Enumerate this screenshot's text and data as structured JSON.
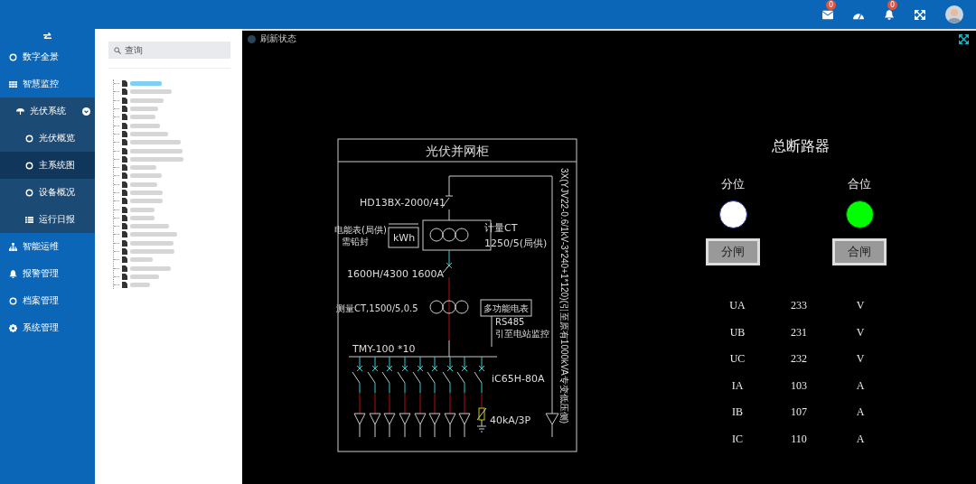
{
  "topbar": {
    "items": [
      {
        "kind": "mail",
        "badge": "0"
      },
      {
        "kind": "dashboard"
      },
      {
        "kind": "bell",
        "badge": "0"
      },
      {
        "kind": "fullscreen"
      },
      {
        "kind": "avatar"
      }
    ]
  },
  "sidebar": {
    "items": [
      {
        "label": "数字全景",
        "selected": false
      },
      {
        "label": "智慧监控",
        "selected": false
      },
      {
        "label": "光伏系统",
        "selected": false,
        "expanded": true,
        "children": [
          {
            "label": "光伏概览",
            "selected": false
          },
          {
            "label": "主系统图",
            "selected": true
          },
          {
            "label": "设备概况",
            "selected": false
          },
          {
            "label": "运行日报",
            "selected": false
          }
        ]
      },
      {
        "label": "智能运维",
        "selected": false
      },
      {
        "label": "报警管理",
        "selected": false
      },
      {
        "label": "档案管理",
        "selected": false
      },
      {
        "label": "系统管理",
        "selected": false
      }
    ]
  },
  "search": {
    "placeholder": "查询"
  },
  "tree": {
    "items": [
      {
        "selected": true
      },
      {
        "selected": false
      },
      {
        "selected": false
      },
      {
        "selected": false
      },
      {
        "selected": false
      },
      {
        "selected": false
      },
      {
        "selected": false
      },
      {
        "selected": false
      },
      {
        "selected": false
      },
      {
        "selected": false
      },
      {
        "selected": false
      },
      {
        "selected": false
      },
      {
        "selected": false
      },
      {
        "selected": false
      },
      {
        "selected": false
      },
      {
        "selected": false
      },
      {
        "selected": false
      },
      {
        "selected": false
      },
      {
        "selected": false
      },
      {
        "selected": false
      },
      {
        "selected": false
      },
      {
        "selected": false
      },
      {
        "selected": false
      },
      {
        "selected": false
      },
      {
        "selected": false
      }
    ]
  },
  "status": {
    "label": "刷新状态"
  },
  "diagram": {
    "title": "光伏并网柜",
    "cable_note": "3X(YJV22-0.6/1kV-3*240+1*120)(引至原有1000kVA专变低压侧)",
    "labels": [
      "HD13BX-2000/41",
      "电能表(局供)",
      "需铅封",
      "kWh",
      "计量CT",
      "1250/5(局供)",
      "1600H/4300 1600A",
      "测量CT,1500/5,0.5",
      "多功能电表",
      "RS485",
      "引至电站监控",
      "TMY-100 *10",
      "iC65H-80A",
      "40kA/3P"
    ]
  },
  "breaker": {
    "title": "总断路器",
    "positions": [
      {
        "label": "分位",
        "on": false,
        "button": "分闸"
      },
      {
        "label": "合位",
        "on": true,
        "button": "合闸"
      }
    ],
    "readings": [
      {
        "name": "UA",
        "value": "233",
        "unit": "V"
      },
      {
        "name": "UB",
        "value": "231",
        "unit": "V"
      },
      {
        "name": "UC",
        "value": "232",
        "unit": "V"
      },
      {
        "name": "IA",
        "value": "103",
        "unit": "A"
      },
      {
        "name": "IB",
        "value": "107",
        "unit": "A"
      },
      {
        "name": "IC",
        "value": "110",
        "unit": "A"
      }
    ]
  }
}
